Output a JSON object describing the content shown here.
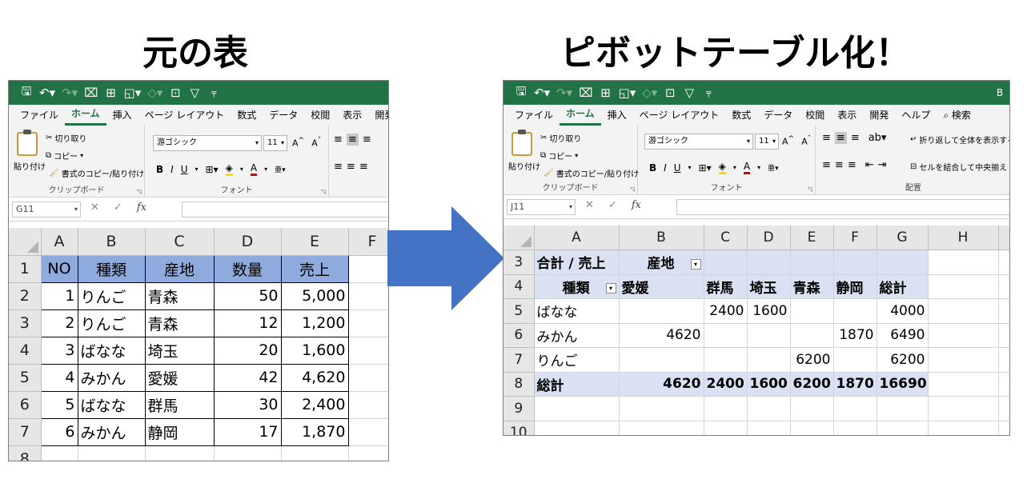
{
  "titles": {
    "left": "元の表",
    "right": "ピボットテーブル化！"
  },
  "colors": {
    "excel_green": "#217346",
    "header_fill": "#8faadc",
    "pivot_fill": "#d9e1f2",
    "arrow_fill": "#4472c4"
  },
  "qat": {
    "icons": [
      "save-icon",
      "undo-icon",
      "redo-icon",
      "custom-icon",
      "table-icon",
      "shapes-icon",
      "filter-icon",
      "qat-menu-icon"
    ],
    "right_edge_text": "B"
  },
  "tabs_left": [
    "ファイル",
    "ホーム",
    "挿入",
    "ページ レイアウト",
    "数式",
    "データ",
    "校閲",
    "表示",
    "開発"
  ],
  "tabs_right": [
    "ファイル",
    "ホーム",
    "挿入",
    "ページ レイアウト",
    "数式",
    "データ",
    "校閲",
    "表示",
    "開発",
    "ヘルプ"
  ],
  "search_label": "検索",
  "ribbon": {
    "paste": "貼り付け",
    "cut": "切り取り",
    "copy": "コピー",
    "format_painter": "書式のコピー/貼り付け",
    "clipboard_group": "クリップボード",
    "font_name": "游ゴシック",
    "font_size": "11",
    "font_group": "フォント",
    "wrap_text": "折り返して全体を表示する",
    "merge_center": "セルを結合して中央揃え",
    "align_group": "配置"
  },
  "left_sheet": {
    "namebox": "G11",
    "columns": [
      "A",
      "B",
      "C",
      "D",
      "E",
      "F"
    ],
    "rows": [
      "1",
      "2",
      "3",
      "4",
      "5",
      "6",
      "7",
      "8"
    ],
    "header": [
      "NO",
      "種類",
      "産地",
      "数量",
      "売上"
    ],
    "data": [
      [
        "1",
        "りんご",
        "青森",
        "50",
        "5,000"
      ],
      [
        "2",
        "りんご",
        "青森",
        "12",
        "1,200"
      ],
      [
        "3",
        "ばなな",
        "埼玉",
        "20",
        "1,600"
      ],
      [
        "4",
        "みかん",
        "愛媛",
        "42",
        "4,620"
      ],
      [
        "5",
        "ばなな",
        "群馬",
        "30",
        "2,400"
      ],
      [
        "6",
        "みかん",
        "静岡",
        "17",
        "1,870"
      ]
    ]
  },
  "right_sheet": {
    "namebox": "J11",
    "columns": [
      "A",
      "B",
      "C",
      "D",
      "E",
      "F",
      "G",
      "H"
    ],
    "rows": [
      "3",
      "4",
      "5",
      "6",
      "7",
      "8",
      "9",
      "10"
    ],
    "pivot_title": "合計 / 売上",
    "col_field": "産地",
    "row_field": "種類",
    "col_headers": [
      "愛媛",
      "群馬",
      "埼玉",
      "青森",
      "静岡",
      "総計"
    ],
    "data": [
      [
        "ばなな",
        "",
        "2400",
        "1600",
        "",
        "",
        "4000"
      ],
      [
        "みかん",
        "4620",
        "",
        "",
        "",
        "1870",
        "6490"
      ],
      [
        "りんご",
        "",
        "",
        "",
        "6200",
        "",
        "6200"
      ]
    ],
    "total": [
      "総計",
      "4620",
      "2400",
      "1600",
      "6200",
      "1870",
      "16690"
    ]
  }
}
